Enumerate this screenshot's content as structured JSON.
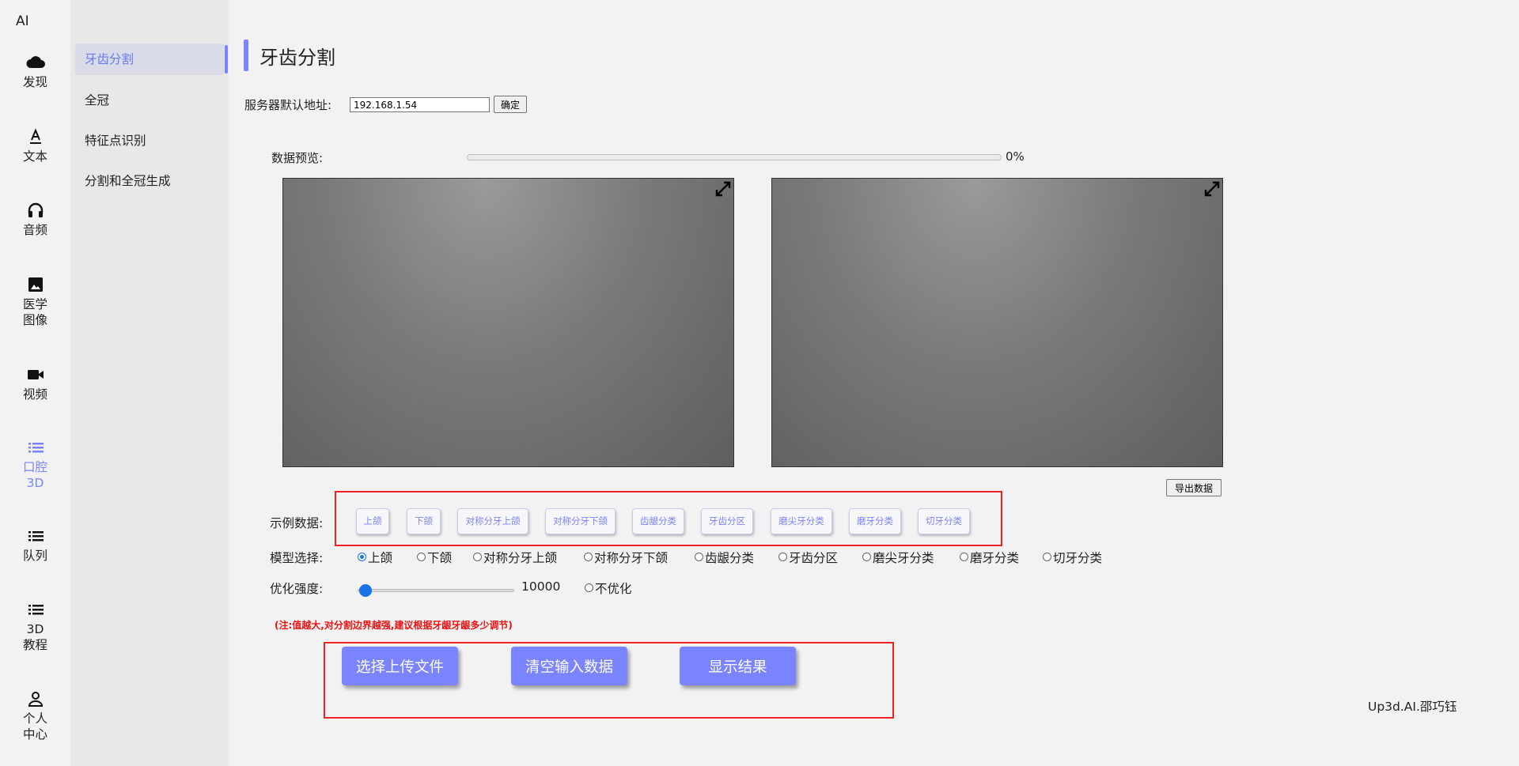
{
  "app": {
    "title": "AI"
  },
  "rail": {
    "items": [
      {
        "label": "发现",
        "icon": "cloud-icon",
        "active": false
      },
      {
        "label": "文本",
        "icon": "text-icon",
        "active": false
      },
      {
        "label": "音频",
        "icon": "headphones-icon",
        "active": false
      },
      {
        "label": "医学\n图像",
        "icon": "image-icon",
        "active": false
      },
      {
        "label": "视频",
        "icon": "video-icon",
        "active": false
      },
      {
        "label": "口腔\n3D",
        "icon": "list-icon",
        "active": true
      },
      {
        "label": "队列",
        "icon": "list-icon",
        "active": false
      },
      {
        "label": "3D\n教程",
        "icon": "list-icon",
        "active": false
      },
      {
        "label": "个人\n中心",
        "icon": "user-icon",
        "active": false
      }
    ]
  },
  "subnav": {
    "items": [
      {
        "label": "牙齿分割",
        "active": true
      },
      {
        "label": "全冠",
        "active": false
      },
      {
        "label": "特征点识别",
        "active": false
      },
      {
        "label": "分割和全冠生成",
        "active": false
      }
    ]
  },
  "page": {
    "title": "牙齿分割"
  },
  "server": {
    "label": "服务器默认地址:",
    "value": "192.168.1.54",
    "confirm_label": "确定"
  },
  "preview": {
    "label": "数据预览:",
    "progress": 0,
    "percent_text": "0%"
  },
  "export_label": "导出数据",
  "examples": {
    "label": "示例数据:",
    "items": [
      "上颌",
      "下颌",
      "对称分牙上颌",
      "对称分牙下颌",
      "齿龈分类",
      "牙齿分区",
      "磨尖牙分类",
      "磨牙分类",
      "切牙分类"
    ]
  },
  "model": {
    "label": "模型选择:",
    "options": [
      "上颌",
      "下颌",
      "对称分牙上颌",
      "对称分牙下颌",
      "齿龈分类",
      "牙齿分区",
      "磨尖牙分类",
      "磨牙分类",
      "切牙分类"
    ],
    "selected": "上颌"
  },
  "optimize": {
    "label": "优化强度:",
    "value_text": "10000",
    "slider_fraction": 0.05,
    "no_opt_label": "不优化"
  },
  "note": "(注:值越大,对分割边界越强,建议根据牙龈牙龈多少调节)",
  "actions": {
    "upload": "选择上传文件",
    "clear": "清空输入数据",
    "show": "显示结果"
  },
  "footer": "Up3d.AI.邵巧钰",
  "colors": {
    "accent": "#7a84ff",
    "annotation": "#ee2222"
  }
}
